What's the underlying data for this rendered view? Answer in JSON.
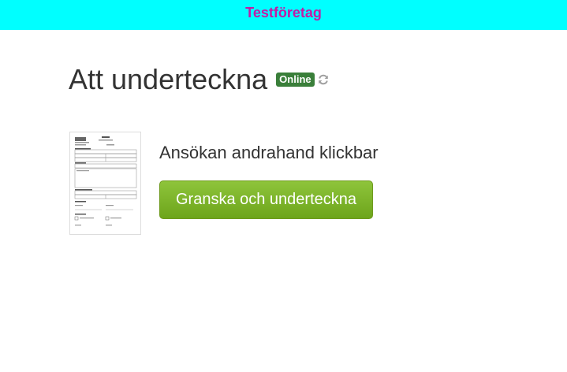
{
  "header": {
    "company_name": "Testföretag",
    "background_color": "#00ffff",
    "text_color": "#c41aa5"
  },
  "main": {
    "title": "Att underteckna",
    "status_badge": "Online",
    "status_badge_color": "#3a7f3a",
    "refresh_icon": "refresh-icon"
  },
  "documents": [
    {
      "thumbnail_icon": "document-thumbnail",
      "name": "Ansökan andrahand klickbar",
      "action_label": "Granska och underteckna",
      "action_color": "#7cb52a"
    }
  ]
}
